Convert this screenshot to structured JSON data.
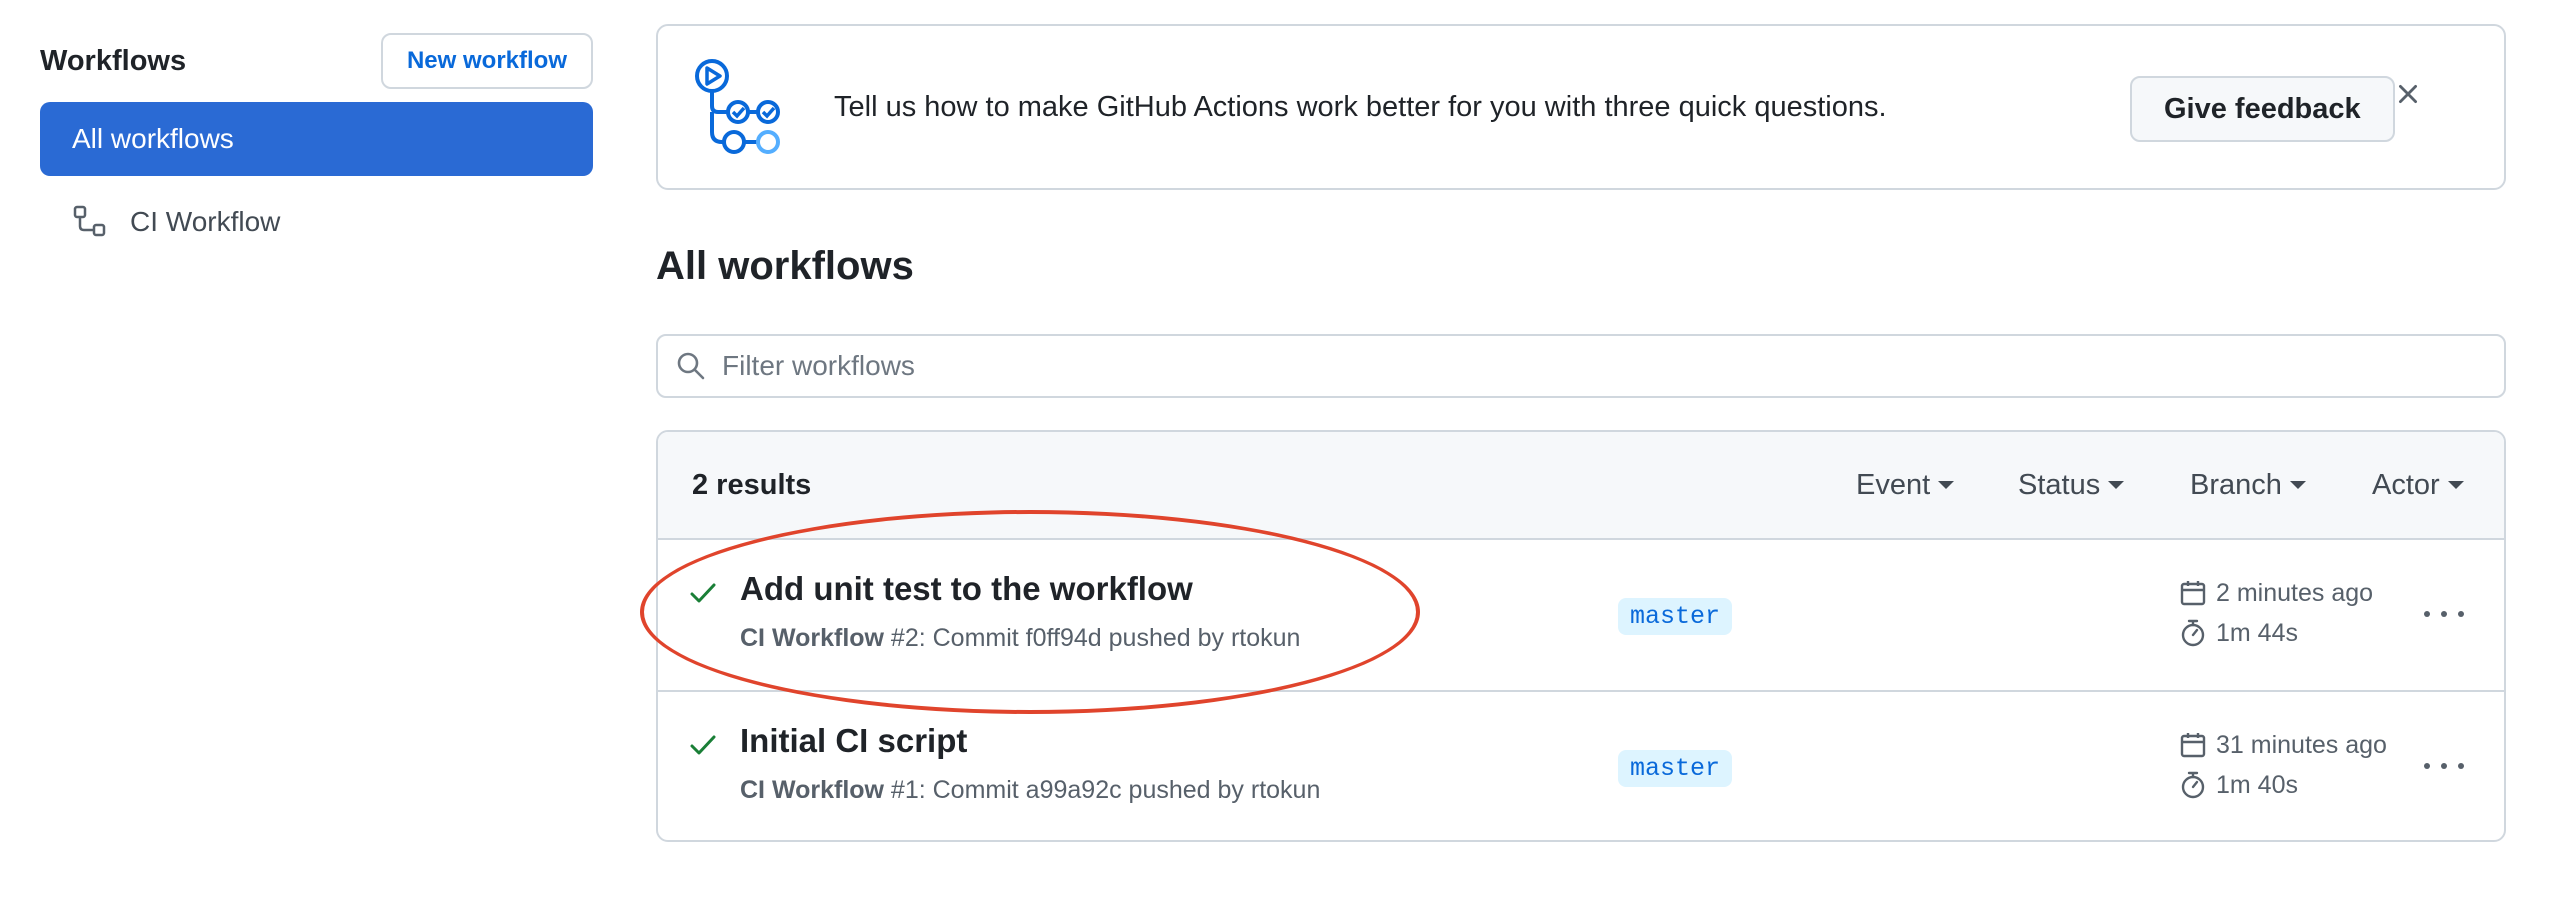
{
  "sidebar": {
    "title": "Workflows",
    "new_workflow_label": "New workflow",
    "items": [
      {
        "label": "All workflows",
        "selected": true
      },
      {
        "label": "CI Workflow",
        "icon": "workflow-icon"
      }
    ]
  },
  "banner": {
    "text": "Tell us how to make GitHub Actions work better for you with three quick questions.",
    "feedback_label": "Give feedback",
    "close_icon": "close-icon"
  },
  "main": {
    "title": "All workflows",
    "filter_placeholder": "Filter workflows",
    "results_count": "2 results",
    "filters": [
      "Event",
      "Status",
      "Branch",
      "Actor"
    ]
  },
  "runs": [
    {
      "title": "Add unit test to the workflow",
      "workflow": "CI Workflow",
      "meta": " #2: Commit f0ff94d pushed by rtokun",
      "branch": "master",
      "time": "2 minutes ago",
      "duration": "1m 44s",
      "status": "success"
    },
    {
      "title": "Initial CI script",
      "workflow": "CI Workflow",
      "meta": " #1: Commit a99a92c pushed by rtokun",
      "branch": "master",
      "time": "31 minutes ago",
      "duration": "1m 40s",
      "status": "success"
    }
  ],
  "colors": {
    "accent": "#2a6ad4",
    "link": "#0969da",
    "success": "#1a7f37",
    "annotation": "#e0442c"
  }
}
